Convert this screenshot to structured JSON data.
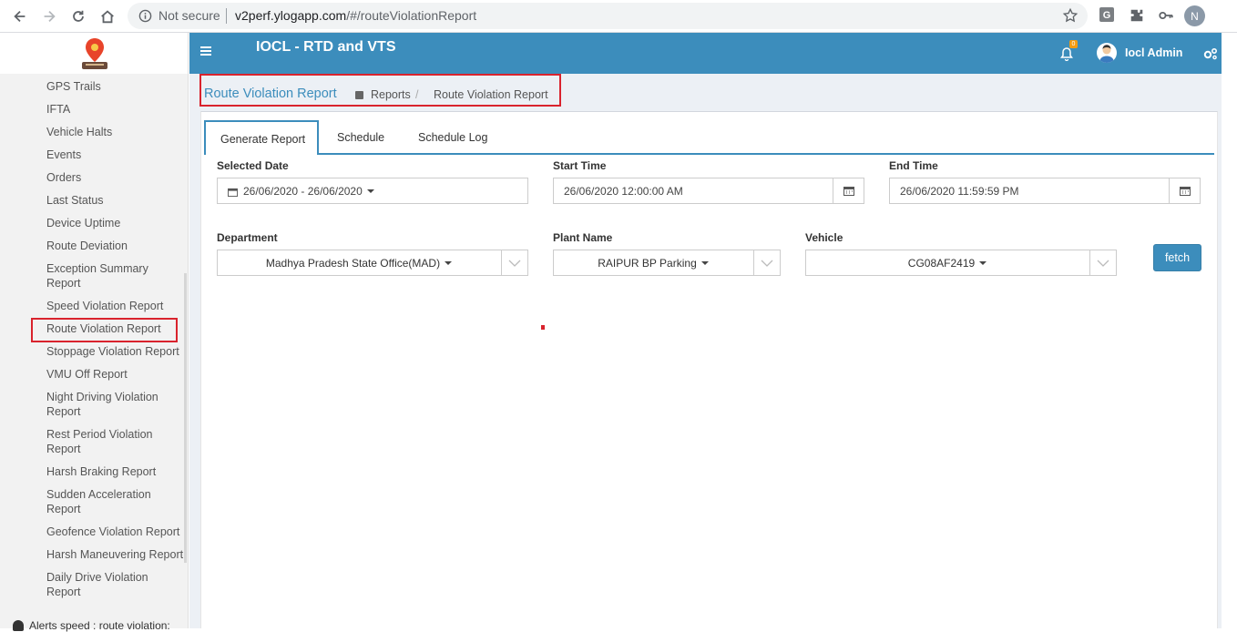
{
  "browser": {
    "security_label": "Not secure",
    "url_domain": "v2perf.ylogapp.com",
    "url_path": "/#/routeViolationReport",
    "profile_initial": "N",
    "extension_g": "G"
  },
  "header": {
    "app_title": "IOCL - RTD and VTS",
    "notification_count": "0",
    "user_name": "Iocl Admin"
  },
  "sidebar": {
    "items": [
      {
        "label": "GPS Trails"
      },
      {
        "label": "IFTA"
      },
      {
        "label": "Vehicle Halts"
      },
      {
        "label": "Events"
      },
      {
        "label": "Orders"
      },
      {
        "label": "Last Status"
      },
      {
        "label": "Device Uptime"
      },
      {
        "label": "Route Deviation"
      },
      {
        "label": "Exception Summary Report"
      },
      {
        "label": "Speed Violation Report"
      },
      {
        "label": "Route Violation Report"
      },
      {
        "label": "Stoppage Violation Report"
      },
      {
        "label": "VMU Off Report"
      },
      {
        "label": "Night Driving Violation Report"
      },
      {
        "label": "Rest Period Violation Report"
      },
      {
        "label": "Harsh Braking Report"
      },
      {
        "label": "Sudden Acceleration Report"
      },
      {
        "label": "Geofence Violation Report"
      },
      {
        "label": "Harsh Maneuvering Report"
      },
      {
        "label": "Daily Drive Violation Report"
      }
    ],
    "alert_text": "Alerts speed : route violation:"
  },
  "page": {
    "title": "Route Violation Report",
    "breadcrumb": {
      "parent": "Reports",
      "separator": "/",
      "current": "Route Violation Report"
    }
  },
  "tabs": {
    "generate": "Generate Report",
    "schedule": "Schedule",
    "log": "Schedule Log"
  },
  "form": {
    "selected_date": {
      "label": "Selected Date",
      "value": "26/06/2020 - 26/06/2020"
    },
    "start_time": {
      "label": "Start Time",
      "value": "26/06/2020 12:00:00 AM"
    },
    "end_time": {
      "label": "End Time",
      "value": "26/06/2020 11:59:59 PM"
    },
    "department": {
      "label": "Department",
      "value": "Madhya Pradesh State Office(MAD)"
    },
    "plant": {
      "label": "Plant Name",
      "value": "RAIPUR BP Parking"
    },
    "vehicle": {
      "label": "Vehicle",
      "value": "CG08AF2419"
    },
    "fetch_label": "fetch"
  },
  "colors": {
    "primary": "#3c8dbc",
    "highlight": "#d9232d",
    "content_bg": "#ecf0f5"
  }
}
